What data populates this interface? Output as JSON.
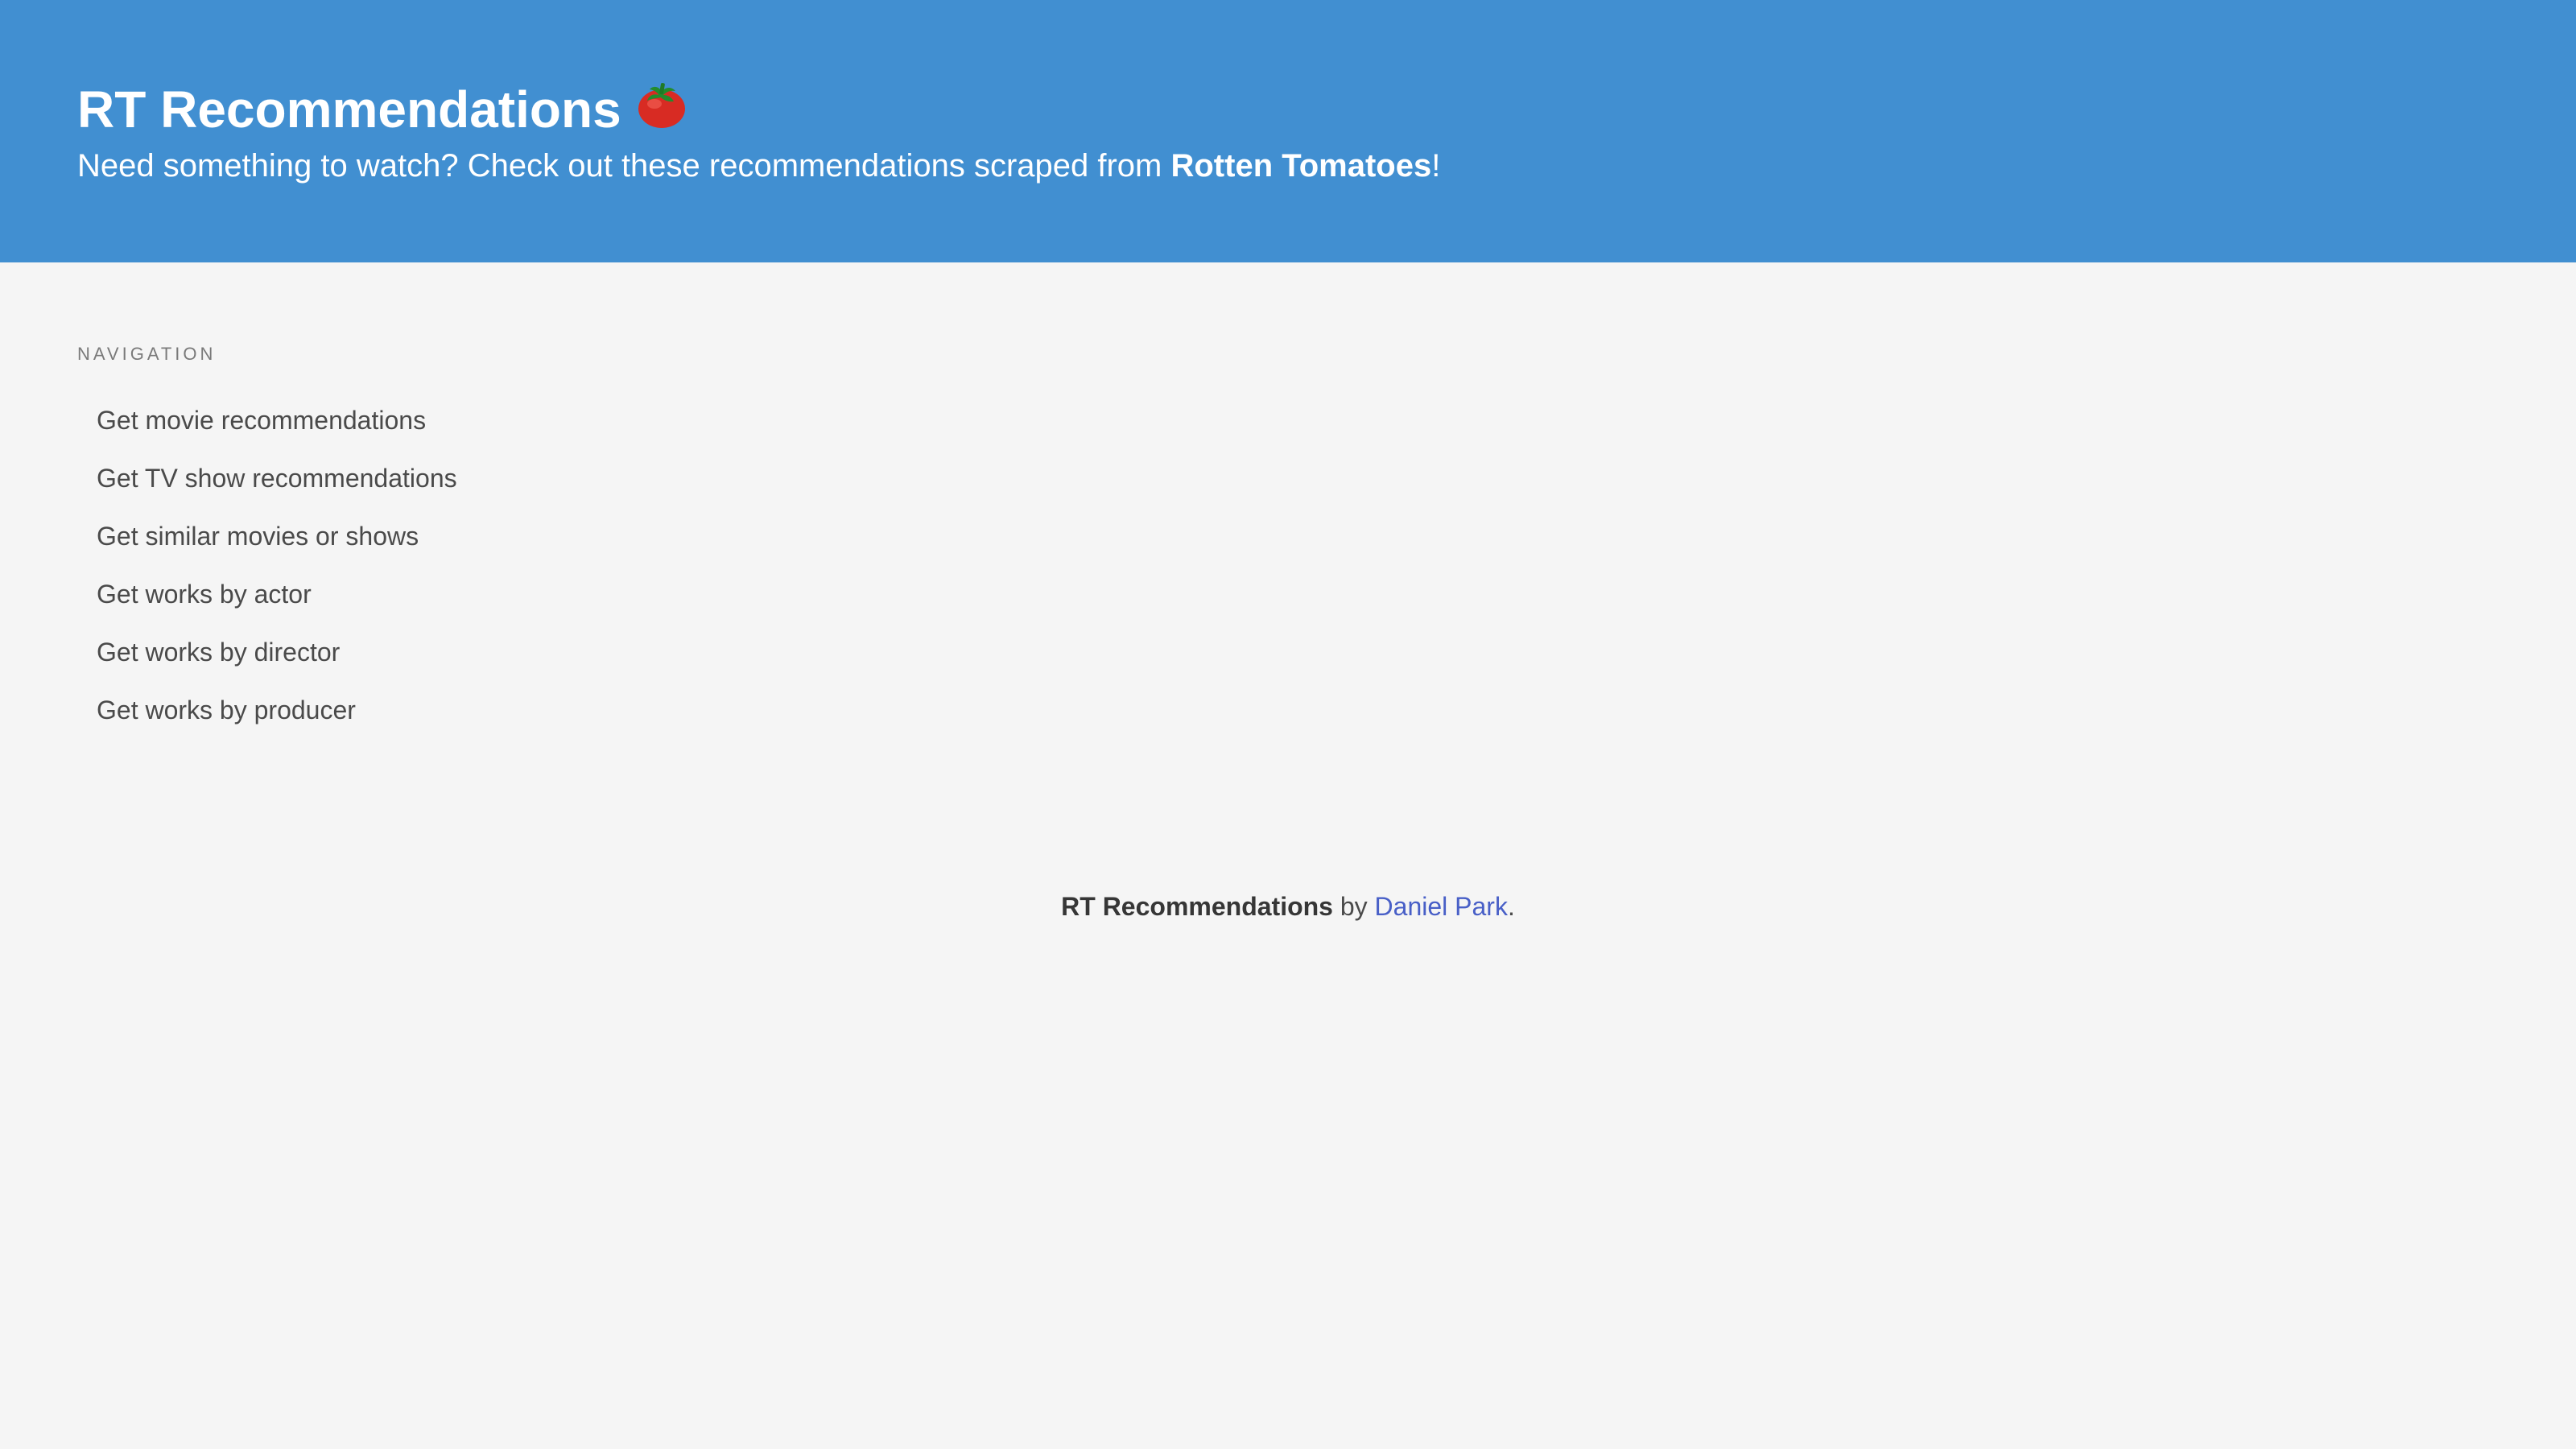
{
  "theme": {
    "hero_background": "#418fd1",
    "page_background": "#f5f5f5",
    "text": "#363636",
    "link": "#485fc7"
  },
  "hero": {
    "title": "RT Recommendations",
    "title_icon": "tomato-icon",
    "subtitle_prefix": "Need something to watch? Check out these recommendations scraped from ",
    "subtitle_emphasis": "Rotten Tomatoes",
    "subtitle_suffix": "!"
  },
  "navigation": {
    "label": "NAVIGATION",
    "items": [
      {
        "label": "Get movie recommendations"
      },
      {
        "label": "Get TV show recommendations"
      },
      {
        "label": "Get similar movies or shows"
      },
      {
        "label": "Get works by actor"
      },
      {
        "label": "Get works by director"
      },
      {
        "label": "Get works by producer"
      }
    ]
  },
  "footer": {
    "app_name": "RT Recommendations",
    "by_text": " by ",
    "author": "Daniel Park",
    "end": "."
  }
}
